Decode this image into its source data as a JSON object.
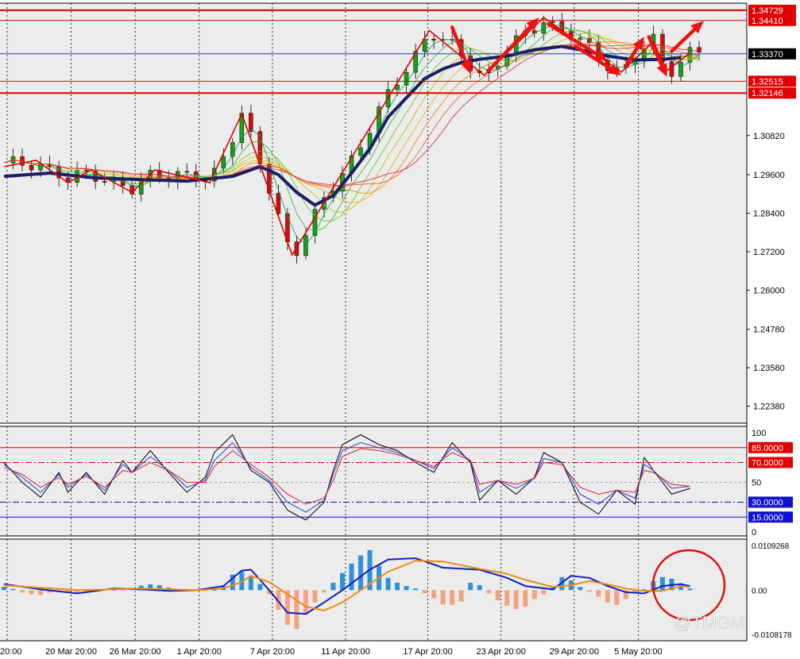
{
  "chart_data": [
    {
      "type": "candlestick",
      "panel": "price",
      "ylim": [
        1.2185,
        1.3495
      ],
      "y_ticks": [
        "1.34729",
        "1.34410",
        "1.33370",
        "1.32515",
        "1.32146",
        "1.30820",
        "1.29600",
        "1.28400",
        "1.27200",
        "1.26000",
        "1.24780",
        "1.23580",
        "1.22380"
      ],
      "horizontal_levels": [
        {
          "value": 1.34729,
          "label": "1.34729",
          "color": "#e00000"
        },
        {
          "value": 1.3441,
          "label": "1.34410",
          "color": "#e00000"
        },
        {
          "value": 1.3337,
          "label": "1.33370",
          "color": "#2040c0"
        },
        {
          "value": 1.32515,
          "label": "1.32515",
          "color": "#e00000"
        },
        {
          "value": 1.32146,
          "label": "1.32146",
          "color": "#e00000"
        }
      ],
      "zigzag": [
        [
          0,
          1.2985
        ],
        [
          3.5,
          1.3005
        ],
        [
          7,
          1.2935
        ],
        [
          9.5,
          1.2975
        ],
        [
          14,
          1.2905
        ],
        [
          16.5,
          1.2975
        ],
        [
          22.5,
          1.2935
        ],
        [
          26,
          1.315
        ],
        [
          31.5,
          1.271
        ],
        [
          46.5,
          1.341
        ],
        [
          52.5,
          1.327
        ],
        [
          59,
          1.345
        ],
        [
          67.5,
          1.328
        ],
        [
          71,
          1.3375
        ],
        [
          72.5,
          1.3285
        ],
        [
          75,
          1.334
        ]
      ],
      "slow_ma": [
        [
          0,
          1.2955
        ],
        [
          5,
          1.2965
        ],
        [
          10,
          1.295
        ],
        [
          15,
          1.2945
        ],
        [
          20,
          1.294
        ],
        [
          25,
          1.2955
        ],
        [
          28,
          1.2985
        ],
        [
          30,
          1.296
        ],
        [
          32,
          1.2905
        ],
        [
          34,
          1.2865
        ],
        [
          36,
          1.2895
        ],
        [
          38,
          1.2965
        ],
        [
          40,
          1.304
        ],
        [
          42,
          1.314
        ],
        [
          44,
          1.32
        ],
        [
          46,
          1.326
        ],
        [
          48,
          1.329
        ],
        [
          50,
          1.331
        ],
        [
          52,
          1.332
        ],
        [
          55,
          1.333
        ],
        [
          58,
          1.335
        ],
        [
          61,
          1.336
        ],
        [
          63,
          1.335
        ],
        [
          66,
          1.333
        ],
        [
          69,
          1.3318
        ],
        [
          72,
          1.332
        ],
        [
          74,
          1.3325
        ]
      ],
      "annotation_arrows": [
        {
          "from": [
            49,
            1.342
          ],
          "to": [
            51,
            1.3275
          ]
        },
        {
          "from": [
            53,
            1.3285
          ],
          "to": [
            58.5,
            1.345
          ]
        },
        {
          "from": [
            59.5,
            1.343
          ],
          "to": [
            66,
            1.3315
          ]
        },
        {
          "from": [
            62.5,
            1.336
          ],
          "to": [
            67.5,
            1.327
          ]
        },
        {
          "from": [
            68,
            1.33
          ],
          "to": [
            70,
            1.339
          ]
        },
        {
          "from": [
            70.5,
            1.339
          ],
          "to": [
            72.5,
            1.3265
          ]
        },
        {
          "from": [
            73,
            1.3345
          ],
          "to": [
            76.5,
            1.344
          ]
        }
      ]
    },
    {
      "type": "line",
      "panel": "stochastic",
      "ylim": [
        0,
        100
      ],
      "y_ticks": [
        "100",
        "50",
        "0"
      ],
      "levels": [
        {
          "value": 85,
          "label": "85.0000",
          "color": "#e00000"
        },
        {
          "value": 70,
          "label": "70.0000",
          "color": "#e00000"
        },
        {
          "value": 30,
          "label": "30.0000",
          "color": "#1010d0"
        },
        {
          "value": 15,
          "label": "15.0000",
          "color": "#1010d0"
        }
      ],
      "series": [
        {
          "color": "#000000",
          "x": [
            0,
            2,
            4,
            6,
            7,
            9,
            11,
            13,
            14,
            16,
            18,
            20,
            22,
            23,
            25,
            27,
            29,
            31,
            33,
            35,
            36,
            37,
            39,
            41,
            43,
            45,
            47,
            49,
            51,
            52,
            54,
            56,
            58,
            59,
            61,
            63,
            65,
            67,
            69,
            70,
            71,
            73,
            75
          ],
          "values": [
            70,
            50,
            35,
            60,
            40,
            60,
            38,
            72,
            60,
            82,
            60,
            40,
            55,
            80,
            98,
            62,
            50,
            22,
            12,
            30,
            62,
            88,
            98,
            88,
            82,
            70,
            60,
            90,
            70,
            32,
            52,
            38,
            55,
            80,
            70,
            30,
            18,
            42,
            28,
            75,
            62,
            38,
            44
          ]
        },
        {
          "color": "#2040e0",
          "x": [
            0,
            2,
            4,
            6,
            7,
            9,
            11,
            13,
            14,
            16,
            18,
            20,
            22,
            23,
            25,
            27,
            29,
            31,
            33,
            35,
            36,
            37,
            39,
            41,
            43,
            45,
            47,
            49,
            51,
            52,
            54,
            56,
            58,
            59,
            61,
            63,
            65,
            67,
            69,
            70,
            71,
            73,
            75
          ],
          "values": [
            68,
            55,
            40,
            58,
            45,
            58,
            42,
            68,
            60,
            76,
            62,
            45,
            52,
            72,
            90,
            65,
            52,
            30,
            20,
            32,
            58,
            82,
            90,
            85,
            80,
            72,
            64,
            85,
            72,
            40,
            52,
            44,
            54,
            74,
            70,
            38,
            28,
            42,
            34,
            68,
            62,
            44,
            46
          ]
        },
        {
          "color": "#e02020",
          "x": [
            0,
            2,
            4,
            6,
            7,
            9,
            11,
            13,
            14,
            16,
            18,
            20,
            22,
            23,
            25,
            27,
            29,
            31,
            33,
            35,
            36,
            37,
            39,
            41,
            43,
            45,
            47,
            49,
            51,
            52,
            54,
            56,
            58,
            59,
            61,
            63,
            65,
            67,
            69,
            70,
            71,
            73,
            75
          ],
          "values": [
            65,
            58,
            45,
            55,
            48,
            56,
            45,
            62,
            60,
            70,
            62,
            50,
            50,
            66,
            82,
            68,
            55,
            38,
            28,
            34,
            52,
            76,
            84,
            82,
            78,
            72,
            66,
            80,
            72,
            48,
            52,
            48,
            54,
            70,
            68,
            45,
            38,
            42,
            40,
            62,
            60,
            48,
            46
          ]
        }
      ]
    },
    {
      "type": "macd",
      "panel": "macd",
      "ylim": [
        -0.0108178,
        0.0109268
      ],
      "y_ticks": [
        "0.0109268",
        "0.00",
        "-0.0108178"
      ],
      "histogram": {
        "x": [
          0,
          1,
          2,
          3,
          4,
          5,
          6,
          7,
          8,
          9,
          10,
          11,
          12,
          13,
          14,
          15,
          16,
          17,
          18,
          19,
          20,
          21,
          22,
          23,
          24,
          25,
          26,
          27,
          28,
          29,
          30,
          31,
          32,
          33,
          34,
          35,
          36,
          37,
          38,
          39,
          40,
          41,
          42,
          43,
          44,
          45,
          46,
          47,
          48,
          49,
          50,
          51,
          52,
          53,
          54,
          55,
          56,
          57,
          58,
          59,
          60,
          61,
          62,
          63,
          64,
          65,
          66,
          67,
          68,
          69,
          70,
          71,
          72,
          73,
          74,
          75
        ],
        "values": [
          0.0008,
          0.0003,
          -0.0006,
          -0.001,
          -0.0012,
          -0.0006,
          -0.0002,
          -0.0007,
          -0.0008,
          -0.0004,
          -0.0001,
          0.0002,
          0.0001,
          -0.0001,
          0.0003,
          0.0011,
          0.0014,
          0.0012,
          0.0006,
          0.0001,
          -0.0002,
          -0.0001,
          -0.0002,
          0.0001,
          0.001,
          0.0038,
          0.0045,
          0.0035,
          0.0015,
          -0.001,
          -0.0048,
          -0.0085,
          -0.0095,
          -0.006,
          -0.003,
          -0.0005,
          0.0018,
          0.0042,
          0.0065,
          0.0085,
          0.0098,
          0.006,
          0.003,
          0.0018,
          0.001,
          0.0004,
          -0.0008,
          -0.002,
          -0.0035,
          -0.0036,
          -0.0028,
          0.0018,
          0.0012,
          -0.0008,
          -0.0025,
          -0.0038,
          -0.0046,
          -0.004,
          -0.0022,
          -0.001,
          0.0006,
          0.0032,
          0.0024,
          0.0008,
          -0.0004,
          -0.0016,
          -0.003,
          -0.0036,
          -0.0022,
          -0.0008,
          0.0002,
          0.0022,
          0.0032,
          0.0028,
          0.0016,
          0.0004
        ]
      },
      "series": [
        {
          "color": "#1020c0",
          "x": [
            0,
            4,
            8,
            12,
            15,
            18,
            21,
            24,
            26,
            27,
            29,
            31,
            33,
            35,
            37,
            40,
            42,
            45,
            48,
            52,
            55,
            57,
            60,
            62,
            64,
            66,
            68,
            70,
            72,
            74,
            75
          ],
          "values": [
            0.0015,
            0.0002,
            -0.0008,
            0.0004,
            0.0002,
            -0.0002,
            0.0,
            0.001,
            0.0048,
            0.005,
            0.0,
            -0.0055,
            -0.0058,
            -0.003,
            0.0,
            0.005,
            0.0075,
            0.0078,
            0.0055,
            0.005,
            0.003,
            0.001,
            0.0002,
            0.0035,
            0.003,
            0.001,
            -0.0005,
            -0.0008,
            0.001,
            0.0015,
            0.001
          ]
        },
        {
          "color": "#f08a10",
          "x": [
            0,
            4,
            8,
            12,
            15,
            18,
            21,
            24,
            26,
            27,
            29,
            31,
            33,
            35,
            37,
            40,
            42,
            45,
            48,
            52,
            55,
            57,
            60,
            62,
            64,
            66,
            68,
            70,
            72,
            74,
            75
          ],
          "values": [
            0.0012,
            0.0006,
            0.0,
            0.0002,
            0.0004,
            0.0002,
            0.0,
            0.0004,
            0.002,
            0.0035,
            0.002,
            -0.001,
            -0.004,
            -0.005,
            -0.003,
            0.0015,
            0.0045,
            0.0072,
            0.007,
            0.0052,
            0.004,
            0.0025,
            0.0008,
            0.0012,
            0.0022,
            0.0014,
            0.0004,
            -0.0002,
            -0.0002,
            0.001,
            0.0008
          ]
        }
      ]
    }
  ],
  "x_axis": {
    "labels": [
      "20:00",
      "20 Mar 20:00",
      "26 Mar 20:00",
      "1 Apr 20:00",
      "7 Apr 20:00",
      "11 Apr 20:00",
      "17 Apr 20:00",
      "23 Apr 20:00",
      "29 Apr 20:00",
      "5 May 20:00"
    ],
    "label_bar_index": [
      0,
      7,
      14,
      21,
      29,
      37,
      46,
      54,
      62,
      69
    ],
    "bar_count": 77
  },
  "colors": {
    "background": "#ececec",
    "bull": "#18a018",
    "bear": "#d01010",
    "level_red": "#e00000",
    "slow_ma": "#1a1f66",
    "zigzag": "#e00000",
    "arrow": "#ee1111",
    "hist_pos": "#3090d8",
    "hist_neg": "#f4a284",
    "circle": "#e01010"
  },
  "watermark": "@TMGM"
}
